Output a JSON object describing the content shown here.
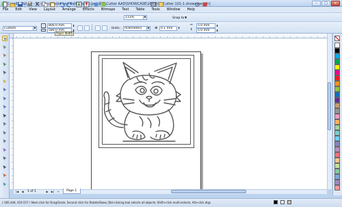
{
  "window": {
    "title": "CorelDRAW X4 - [C:\\Documents and Settings\\jim.pro\\桌面\\Cutter AAD\\SHOWCASE\\2012\\01\\Cutter 101-1 showcase.cdr]",
    "buttons": {
      "minimize": "–",
      "maximize": "□",
      "close": "×"
    }
  },
  "menu": [
    "File",
    "Edit",
    "View",
    "Layout",
    "Arrange",
    "Effects",
    "Bitmaps",
    "Text",
    "Table",
    "Tools",
    "Window",
    "Help"
  ],
  "toolbar": {
    "zoom": "113%",
    "snap_to": "Snap to"
  },
  "property_bar": {
    "preset": "Custom",
    "page_width": "800.0 mm",
    "page_height": "580.0 mm",
    "units_label": "Units:",
    "units_value": "millimeters",
    "nudge": "0.1 mm",
    "duplicate_x": "5.0 mm",
    "duplicate_y": "5.0 mm"
  },
  "tooltip": "Paper Width",
  "pages": {
    "counter": "1 of 1",
    "tab": "Page 1",
    "nav_first": "|◀",
    "nav_prev": "◀",
    "nav_next": "▶",
    "nav_last": "▶|",
    "nav_add": "+"
  },
  "status": {
    "text": "(-185.444, 419.557 )   Next click for Drag/Scale; Second click for Rotate/Skew; Dbl-clicking tool selects all objects; Shift+click multi-selects; Alt+click digs"
  },
  "palette_colors": [
    "#ffffff",
    "#000000",
    "#00aeef",
    "#00a651",
    "#fff200",
    "#ec008c",
    "#ed1c24",
    "#f7941d",
    "#8dc63f",
    "#0072bc",
    "#662d91",
    "#c69c6d",
    "#959595",
    "#f49ac1",
    "#fbaf5d",
    "#a3d39c",
    "#7accc8",
    "#6dcff6",
    "#8781bd",
    "#bd8cbf",
    "#f26d7d",
    "#fdc689",
    "#c4df9b",
    "#82ca9c",
    "#7da7d9",
    "#a186be",
    "#f5989d"
  ],
  "icons": {
    "toolbar": [
      "new-icon",
      "open-icon",
      "save-icon",
      "print-icon",
      "cut-icon",
      "copy-icon",
      "paste-icon",
      "undo-icon",
      "redo-icon",
      "import-icon",
      "export-icon",
      "app-launcher-icon",
      "welcome-icon"
    ],
    "toolbox": [
      "pick-tool-icon",
      "shape-tool-icon",
      "crop-tool-icon",
      "zoom-tool-icon",
      "freehand-tool-icon",
      "smart-fill-icon",
      "rectangle-tool-icon",
      "ellipse-tool-icon",
      "polygon-tool-icon",
      "text-tool-icon",
      "table-tool-icon",
      "dimension-tool-icon",
      "connector-tool-icon",
      "blend-tool-icon",
      "eyedropper-icon",
      "outline-pen-icon",
      "fill-tool-icon",
      "interactive-fill-icon"
    ]
  }
}
